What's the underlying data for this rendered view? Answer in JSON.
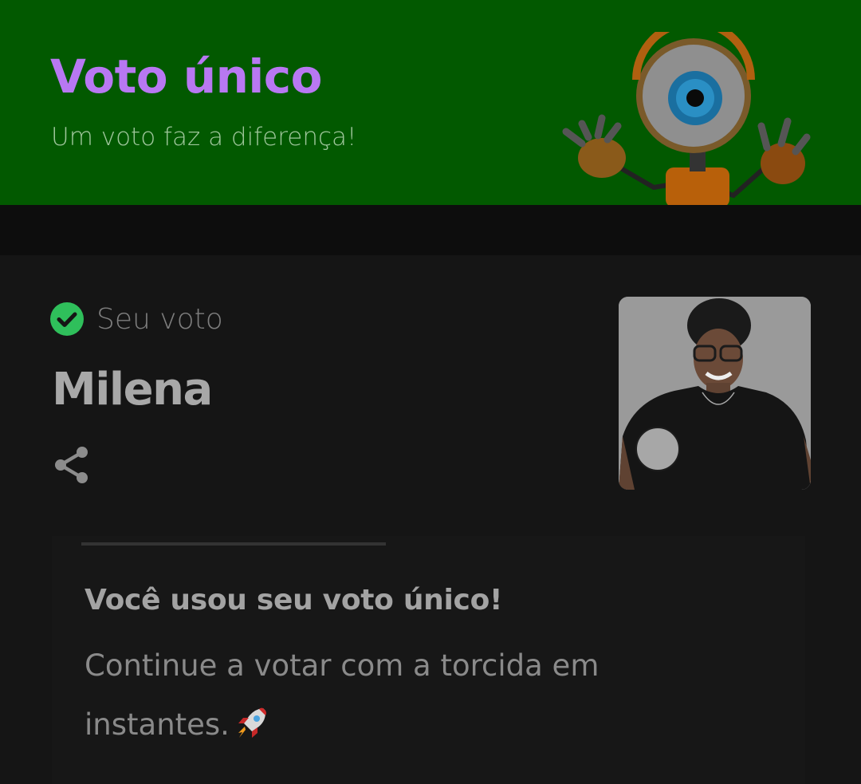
{
  "banner": {
    "title": "Voto único",
    "subtitle": "Um voto faz a diferença!",
    "background": "#025900",
    "title_color": "#b878f2"
  },
  "vote": {
    "status_label": "Seu voto",
    "status_icon": "check-circle-icon",
    "status_color": "#2fbf5b",
    "candidate_name": "Milena",
    "share_icon": "share-icon"
  },
  "message": {
    "title": "Você usou seu voto único!",
    "body": "Continue a votar com a torcida em instantes.",
    "emoji_icon": "rocket-icon"
  }
}
